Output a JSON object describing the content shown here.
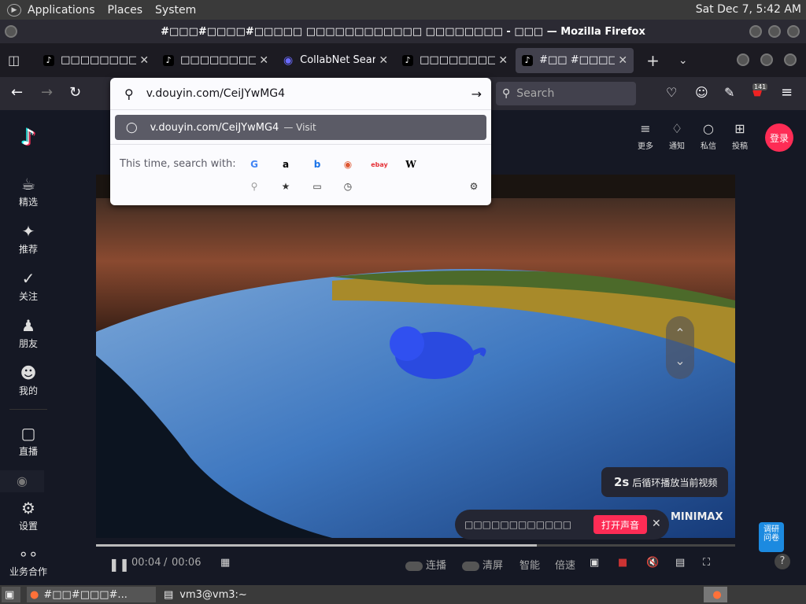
{
  "top_panel": {
    "menus": [
      "Applications",
      "Places",
      "System"
    ],
    "clock": "Sat Dec 7,  5:42 AM"
  },
  "window": {
    "title": "#□□□#□□□□#□□□□□ □□□□□□□□□□□□ □□□□□□□□ - □□□ — Mozilla Firefox"
  },
  "tabs": [
    {
      "label": "□□□□□□□□",
      "favicon": "tiktok-icon",
      "active": false
    },
    {
      "label": "□□□□□□□□",
      "favicon": "tiktok-icon",
      "active": false
    },
    {
      "label": "CollabNet Sear",
      "favicon": "collabnet-icon",
      "active": false
    },
    {
      "label": "□□□□□□□□",
      "favicon": "tiktok-icon",
      "active": false
    },
    {
      "label": "#□□ #□□□□",
      "favicon": "tiktok-icon",
      "active": true
    }
  ],
  "navbar": {
    "search_placeholder": "Search",
    "badge_count": "141"
  },
  "urlbar": {
    "value": "v.douyin.com/CeiJYwMG4",
    "result_url": "v.douyin.com/CeiJYwMG4",
    "result_action": "— Visit",
    "search_with_label": "This time, search with:",
    "engines": [
      "google-icon",
      "amazon-icon",
      "bing-icon",
      "duckduckgo-icon",
      "ebay-icon",
      "wikipedia-icon"
    ],
    "modes": [
      "search-icon",
      "bookmark-icon",
      "tabs-icon",
      "history-icon"
    ]
  },
  "sidebar": {
    "items": [
      {
        "label": "精选",
        "icon": "featured-icon"
      },
      {
        "label": "推荐",
        "icon": "recommend-icon"
      },
      {
        "label": "关注",
        "icon": "follow-icon"
      },
      {
        "label": "朋友",
        "icon": "friends-icon"
      },
      {
        "label": "我的",
        "icon": "profile-icon"
      },
      {
        "label": "直播",
        "icon": "live-icon"
      },
      {
        "label": "设置",
        "icon": "settings-icon"
      },
      {
        "label": "业务合作",
        "icon": "business-icon"
      }
    ]
  },
  "header": {
    "items": [
      {
        "label": "更多",
        "icon": "menu-icon"
      },
      {
        "label": "通知",
        "icon": "bell-icon"
      },
      {
        "label": "私信",
        "icon": "message-icon"
      },
      {
        "label": "投稿",
        "icon": "upload-icon"
      }
    ],
    "login_label": "登录"
  },
  "video": {
    "watermark": "MINIMAX",
    "time_current": "00:04",
    "time_total": "00:06",
    "progress": 0.69,
    "controls": {
      "autoplay": "连播",
      "clear": "清屏",
      "smart": "智能",
      "speed": "倍速"
    },
    "loop_tip_seconds": "2s",
    "loop_tip_text": "后循环播放当前视频",
    "sound_tip_text": "□□□□□□□□□□□□",
    "sound_button": "打开声音"
  },
  "feedback_label": "调研\n问卷",
  "taskbar": {
    "tasks": [
      {
        "label": "#□□#□□□#...",
        "icon": "firefox-icon"
      },
      {
        "label": "vm3@vm3:~",
        "icon": "terminal-icon"
      }
    ]
  },
  "colors": {
    "accent": "#fe2c55",
    "page_bg": "#151824"
  }
}
